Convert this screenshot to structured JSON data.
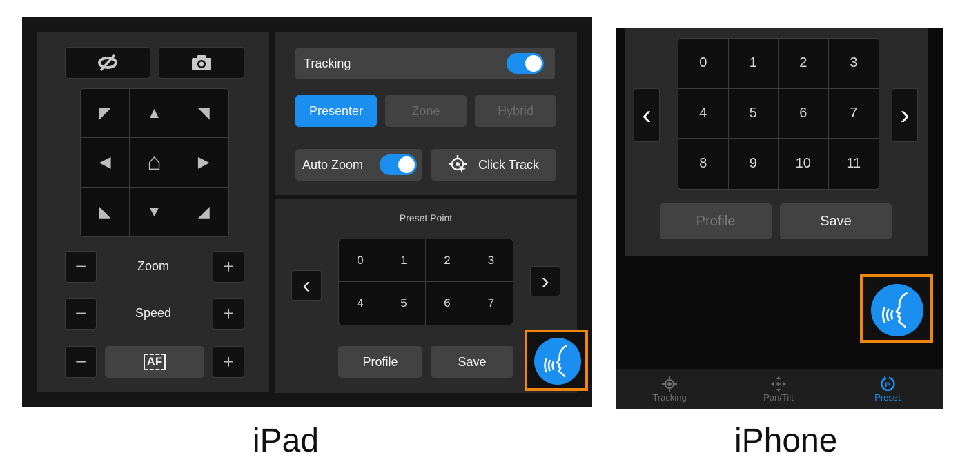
{
  "ipad": {
    "top_buttons": [
      {
        "icon": "eye-off-icon"
      },
      {
        "icon": "camera-icon"
      }
    ],
    "direction_pad": [
      {
        "icon": "arrow-up-left-icon",
        "glyph": "◤"
      },
      {
        "icon": "arrow-up-icon",
        "glyph": "▲"
      },
      {
        "icon": "arrow-up-right-icon",
        "glyph": "◥"
      },
      {
        "icon": "arrow-left-icon",
        "glyph": "◀"
      },
      {
        "icon": "home-icon",
        "glyph": "⌂"
      },
      {
        "icon": "arrow-right-icon",
        "glyph": "▶"
      },
      {
        "icon": "arrow-down-left-icon",
        "glyph": "◣"
      },
      {
        "icon": "arrow-down-icon",
        "glyph": "▼"
      },
      {
        "icon": "arrow-down-right-icon",
        "glyph": "◢"
      }
    ],
    "zoom_label": "Zoom",
    "speed_label": "Speed",
    "af_label": "AF",
    "minus": "−",
    "plus": "+",
    "tracking": {
      "label": "Tracking",
      "enabled": true,
      "modes": [
        "Presenter",
        "Zone",
        "Hybrid"
      ],
      "selected_mode": "Presenter",
      "auto_zoom_label": "Auto Zoom",
      "auto_zoom_enabled": true,
      "click_track_label": "Click Track"
    },
    "preset": {
      "title": "Preset Point",
      "numbers": [
        "0",
        "1",
        "2",
        "3",
        "4",
        "5",
        "6",
        "7"
      ],
      "prev": "‹",
      "next": "›",
      "profile_label": "Profile",
      "save_label": "Save"
    }
  },
  "iphone": {
    "preset": {
      "numbers": [
        "0",
        "1",
        "2",
        "3",
        "4",
        "5",
        "6",
        "7",
        "8",
        "9",
        "10",
        "11"
      ],
      "prev": "‹",
      "next": "›",
      "profile_label": "Profile",
      "save_label": "Save"
    },
    "tabs": [
      {
        "label": "Tracking",
        "icon": "tracking-icon",
        "active": false
      },
      {
        "label": "Pan/Tilt",
        "icon": "pan-tilt-icon",
        "active": false
      },
      {
        "label": "Preset",
        "icon": "preset-icon",
        "active": true
      }
    ]
  },
  "captions": {
    "ipad": "iPad",
    "iphone": "iPhone"
  },
  "colors": {
    "accent": "#1a8fef",
    "highlight": "#f0860f",
    "panel": "#2a2a2a"
  }
}
